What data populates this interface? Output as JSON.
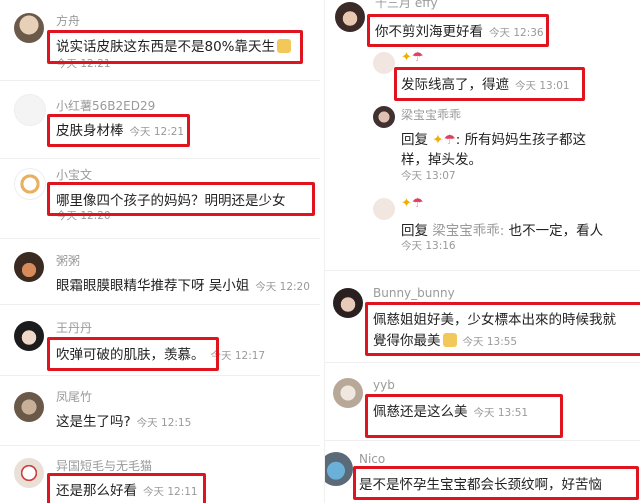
{
  "left": {
    "comments": [
      {
        "name": "方舟",
        "text": "说实话皮肤这东西是不是80%靠天生",
        "time": "今天 12:21"
      },
      {
        "name": "小红薯56B2ED29",
        "text": "皮肤身材棒",
        "time": "今天 12:21"
      },
      {
        "name": "小宝文",
        "text": "哪里像四个孩子的妈妈？明明还是少女",
        "time": "今天 12:20"
      },
      {
        "name": "粥粥",
        "text": "眼霜眼膜眼精华推荐下呀 吴小姐",
        "time": "今天 12:20"
      },
      {
        "name": "王丹丹",
        "text": "吹弹可破的肌肤，羡慕。",
        "time": "今天 12:17"
      },
      {
        "name": "凤尾竹",
        "text": "这是生了吗?",
        "time": "今天 12:15"
      },
      {
        "name": "异国短毛与无毛猫",
        "text": "还是那么好看",
        "time": "今天 12:11"
      }
    ]
  },
  "right": {
    "comments": [
      {
        "name": "十三月 effy",
        "text": "你不剪刘海更好看",
        "time": "今天 12:36"
      },
      {
        "text": "发际线高了，得遮",
        "time": "今天 13:01"
      },
      {
        "name": "梁宝宝乖乖",
        "reply": "回复",
        "text1": "所有妈妈生孩子都这",
        "text2": "样，掉头发。",
        "time": "今天 13:07"
      },
      {
        "reply": "回复",
        "reply_to": "梁宝宝乖乖:",
        "text": "也不一定，看人",
        "time": "今天 13:16"
      },
      {
        "name": "Bunny_bunny",
        "text1": "佩慈姐姐好美，少女標本出來的時候我就",
        "text2": "覺得你最美",
        "time": "今天 13:55"
      },
      {
        "name": "yyb",
        "text": "佩慈还是这么美",
        "time": "今天 13:51"
      },
      {
        "name": "Nico",
        "text": "是不是怀孕生宝宝都会长颈纹啊，好苦恼"
      }
    ]
  },
  "colors": {
    "highlight": "#e0141e",
    "meta": "#9a9a9a",
    "text": "#222222"
  }
}
